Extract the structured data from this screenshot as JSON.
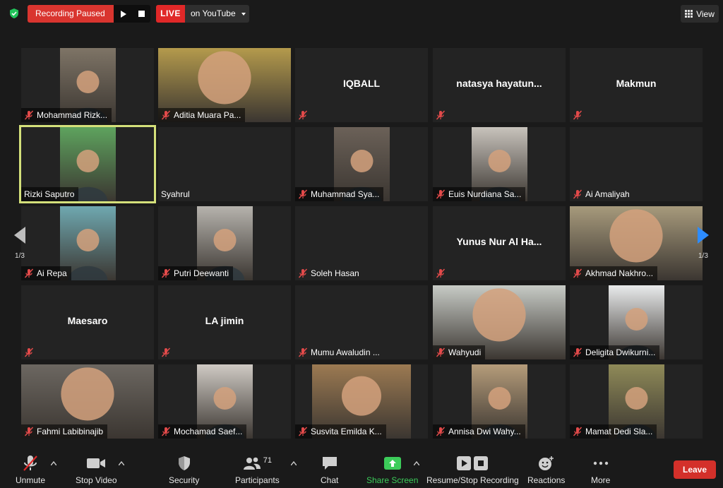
{
  "topbar": {
    "recording_label": "Recording Paused",
    "live_label": "LIVE",
    "live_target": "on YouTube",
    "view_label": "View"
  },
  "pagination": {
    "left": "1/3",
    "right": "1/3"
  },
  "tiles": [
    {
      "name": "Mohammad Rizk...",
      "muted": true,
      "video": true,
      "video_color": "#7e7466",
      "center": false
    },
    {
      "name": "Aditia Muara Pa...",
      "muted": true,
      "video": true,
      "video_color": "#b49a4c",
      "center": false
    },
    {
      "name": "IQBALL",
      "muted": true,
      "video": false,
      "center": true
    },
    {
      "name": "natasya  hayatun...",
      "muted": true,
      "video": false,
      "center": true
    },
    {
      "name": "Makmun",
      "muted": true,
      "video": false,
      "center": true
    },
    {
      "name": "Rizki Saputro",
      "muted": false,
      "video": true,
      "video_color": "#5ea35e",
      "center": false,
      "active": true
    },
    {
      "name": "Syahrul",
      "muted": false,
      "video": false,
      "center": false
    },
    {
      "name": "Muhammad Sya...",
      "muted": true,
      "video": true,
      "video_color": "#6b6158",
      "center": false
    },
    {
      "name": "Euis Nurdiana Sa...",
      "muted": true,
      "video": true,
      "video_color": "#c8c3bc",
      "center": false
    },
    {
      "name": "Ai Amaliyah",
      "muted": true,
      "video": false,
      "center": false
    },
    {
      "name": "Ai Repa",
      "muted": true,
      "video": true,
      "video_color": "#6fa8b0",
      "center": false
    },
    {
      "name": "Putri Deewanti",
      "muted": true,
      "video": true,
      "video_color": "#b6b3ad",
      "center": false
    },
    {
      "name": "Soleh Hasan",
      "muted": true,
      "video": false,
      "center": false
    },
    {
      "name": "Yunus Nur Al Ha...",
      "muted": true,
      "video": false,
      "center": true
    },
    {
      "name": "Akhmad Nakhro...",
      "muted": true,
      "video": true,
      "video_color": "#a79a7c",
      "center": false
    },
    {
      "name": "Maesaro",
      "muted": true,
      "video": false,
      "center": true
    },
    {
      "name": "LA jimin",
      "muted": true,
      "video": false,
      "center": true
    },
    {
      "name": "Mumu Awaludin ...",
      "muted": true,
      "video": false,
      "center": false
    },
    {
      "name": "Wahyudi",
      "muted": true,
      "video": true,
      "video_color": "#c7cbc6",
      "center": false
    },
    {
      "name": "Deligita Dwikurni...",
      "muted": true,
      "video": true,
      "video_color": "#e9ebec",
      "center": false
    },
    {
      "name": "Fahmi Labibinajib",
      "muted": true,
      "video": true,
      "video_color": "#6c6761",
      "center": false
    },
    {
      "name": "Mochamad Saef...",
      "muted": true,
      "video": true,
      "video_color": "#cfcac4",
      "center": false
    },
    {
      "name": "Susvita Emilda K...",
      "muted": true,
      "video": true,
      "video_color": "#9c7a52",
      "center": false
    },
    {
      "name": "Annisa Dwi Wahy...",
      "muted": true,
      "video": true,
      "video_color": "#b59c7a",
      "center": false
    },
    {
      "name": "Mamat Dedi Sla...",
      "muted": true,
      "video": true,
      "video_color": "#8f8a58",
      "center": false
    }
  ],
  "toolbar": {
    "unmute": "Unmute",
    "stop_video": "Stop Video",
    "security": "Security",
    "participants": "Participants",
    "participants_count": "71",
    "chat": "Chat",
    "share_screen": "Share Screen",
    "recording": "Resume/Stop Recording",
    "reactions": "Reactions",
    "more": "More",
    "leave": "Leave"
  },
  "colors": {
    "accent_green": "#3ccc5a",
    "live_red": "#e02828",
    "leave_red": "#d3302a",
    "active_border": "#d4e07a"
  }
}
